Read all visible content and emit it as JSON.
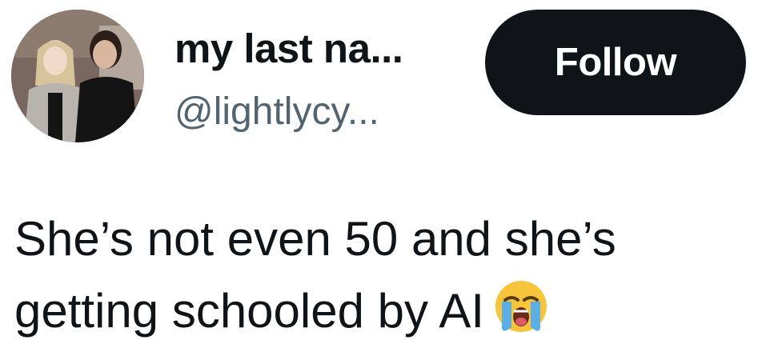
{
  "author": {
    "display_name": "my last na...",
    "handle": "@lightlycy..."
  },
  "follow_button": {
    "label": "Follow"
  },
  "tweet": {
    "line1": "She’s not even 50 and she’s",
    "line2": "getting schooled by AI",
    "emoji": "loudly-crying-face"
  },
  "colors": {
    "text": "#0f1419",
    "handle": "#536471",
    "button_bg": "#0f1419",
    "button_text": "#ffffff"
  }
}
